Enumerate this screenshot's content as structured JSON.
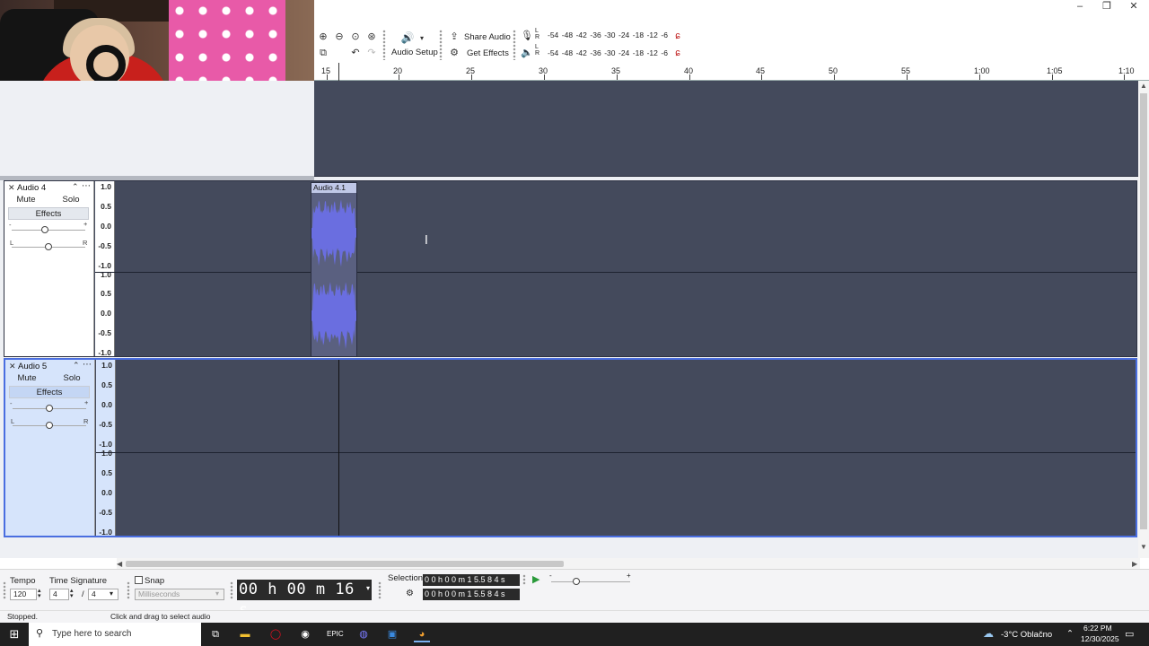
{
  "window": {
    "minimize": "–",
    "restore": "❐",
    "close": "✕"
  },
  "toolbar": {
    "audio_setup_label": "Audio Setup",
    "share_audio_label": "Share Audio",
    "get_effects_label": "Get Effects",
    "meter_scale": [
      "-54",
      "-48",
      "-42",
      "-36",
      "-30",
      "-24",
      "-18",
      "-12",
      "-6"
    ],
    "meter_rec_lr": "L\nR",
    "meter_play_lr": "L\nR"
  },
  "ruler": {
    "ticks": [
      "15",
      "20",
      "25",
      "30",
      "35",
      "40",
      "45",
      "50",
      "55",
      "1:00",
      "1:05",
      "1:10"
    ]
  },
  "tracks": [
    {
      "name": "Audio 4",
      "mute_label": "Mute",
      "solo_label": "Solo",
      "effects_label": "Effects",
      "gain_minus": "-",
      "gain_plus": "+",
      "pan_left": "L",
      "pan_right": "R",
      "gain_level": 0.45,
      "pan_level": 0.5,
      "scale": [
        "1.0",
        "0.5",
        "0.0",
        "-0.5",
        "-1.0",
        "1.0",
        "0.5",
        "0.0",
        "-0.5",
        "-1.0"
      ]
    },
    {
      "name": "Audio 5",
      "mute_label": "Mute",
      "solo_label": "Solo",
      "effects_label": "Effects",
      "gain_minus": "-",
      "gain_plus": "+",
      "pan_left": "L",
      "pan_right": "R",
      "gain_level": 0.5,
      "pan_level": 0.5,
      "scale": [
        "1.0",
        "0.5",
        "0.0",
        "-0.5",
        "-1.0",
        "1.0",
        "0.5",
        "0.0",
        "-0.5",
        "-1.0"
      ]
    }
  ],
  "clip": {
    "name": "Audio 4.1",
    "color": "#6a6ee0"
  },
  "bottom": {
    "tempo_label": "Tempo",
    "tempo_value": "120",
    "time_signature_label": "Time Signature",
    "ts_top": "4",
    "ts_sep": "/",
    "ts_bottom": "4",
    "snap_label": "Snap",
    "snap_unit": "Milliseconds",
    "time_display": "00 h 00 m 16 s",
    "selection_label": "Selection",
    "selection_start": "0 0 h 0 0 m 1 5.5 8 4 s",
    "selection_end": "0 0 h 0 0 m 1 5.5 8 4 s",
    "playback_speed_min": "-",
    "playback_speed_max": "+"
  },
  "status": {
    "state": "Stopped.",
    "hint": "Click and drag to select audio"
  },
  "taskbar": {
    "search_placeholder": "Type here to search",
    "weather": "-3°C  Oblačno",
    "time": "6:22 PM",
    "date": "12/30/2025"
  },
  "colors": {
    "track_bg": "#444a5c",
    "selection_border": "#4a6ee0",
    "selected_tcp": "#d6e4fb"
  }
}
